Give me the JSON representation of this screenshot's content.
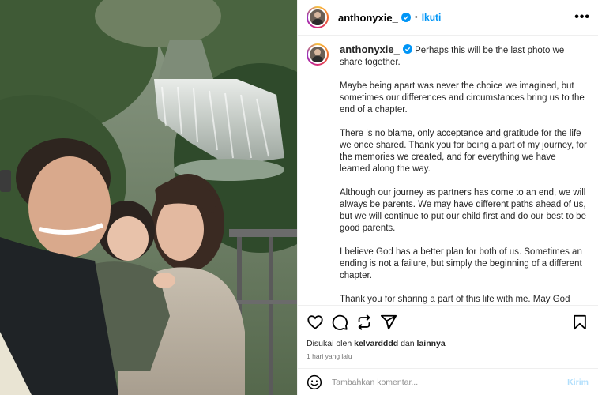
{
  "post": {
    "username": "anthonyxie_",
    "separator": "•",
    "follow_label": "Ikuti",
    "more_label": "•••",
    "caption_first": "Perhaps this will be the last photo we share together.",
    "caption_paragraphs": [
      "Maybe being apart was never the choice we imagined, but sometimes our differences and circumstances bring us to the end of a chapter.",
      "There is no blame, only acceptance and gratitude for the life we once shared. Thank you for being a part of my journey, for the memories we created, and for everything we have learned along the way.",
      "Although our journey as partners has come to an end, we will always be parents. We may have different paths ahead of us, but we will continue to put our child first and do our best to be good parents.",
      "I believe God has a better plan for both of us. Sometimes an ending is not a failure, but simply the beginning of a different chapter.",
      "Thank you for sharing a part of this life with me. May God guide us both toward the lives He has prepared for us. 🤍 AX"
    ]
  },
  "likes": {
    "prefix": "Disukai oleh",
    "user": "kelvardddd",
    "conjunction": "dan",
    "others": "lainnya"
  },
  "timestamp": "1 hari yang lalu",
  "comment": {
    "placeholder": "Tambahkan komentar...",
    "post_label": "Kirim"
  },
  "icons": [
    "heart-icon",
    "comment-icon",
    "repost-icon",
    "share-icon",
    "bookmark-icon",
    "emoji-icon",
    "verified-badge-icon"
  ],
  "colors": {
    "accent": "#0095f6",
    "post_disabled": "#b2dffc",
    "border": "#efefef",
    "muted": "#737373"
  }
}
